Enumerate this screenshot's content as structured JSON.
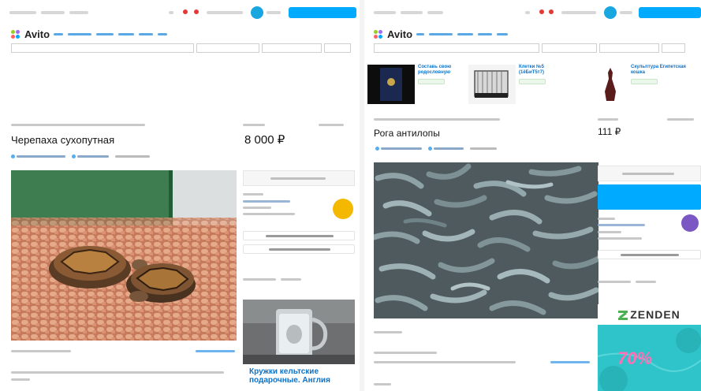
{
  "left": {
    "logo": "Avito",
    "title": "Черепаха сухопутная",
    "price": "8 000 ₽",
    "ad": {
      "title": "Кружки кельтские подарочные. Англия"
    }
  },
  "right": {
    "logo": "Avito",
    "title": "Рога антилопы",
    "price": "111 ₽",
    "recommendations": [
      {
        "title": "Составь свою родословную"
      },
      {
        "title": "Клетки №5 (1ёБиТ5т7)"
      },
      {
        "title": "Скульптура Египетская кошка"
      }
    ],
    "banner": {
      "brand": "ZENDEN",
      "discount": "70%"
    }
  },
  "colors": {
    "accent": "#00aaff",
    "link": "#0a72c9",
    "seller_avatar_left": "#f5b800",
    "seller_avatar_right": "#7b57c4",
    "promo_bg": "#2fc4c9",
    "promo_text": "#ff6fb5"
  }
}
